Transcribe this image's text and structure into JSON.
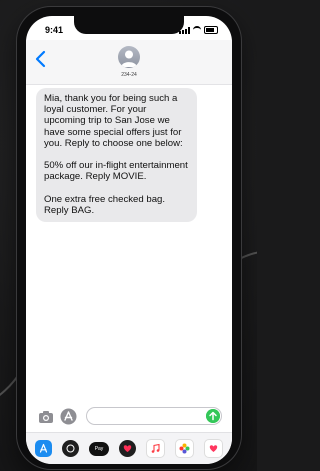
{
  "status_bar": {
    "time": "9:41"
  },
  "header": {
    "sender": "234-24"
  },
  "message": {
    "text": "Mia, thank you for being such a loyal customer. For your upcoming trip to San Jose we have some special offers just for you. Reply to choose one below:\n\n50% off our in-flight entertainment package. Reply MOVIE.\n\nOne extra free checked bag. Reply BAG."
  },
  "app_strip": {
    "pay_label": "Pay"
  },
  "colors": {
    "bubble": "#e9e9eb",
    "accent_blue": "#007aff",
    "send_green": "#34c759"
  },
  "icons": [
    "back-icon",
    "avatar",
    "camera-icon",
    "app-store-icon",
    "send-icon",
    "app-store-app-icon",
    "apple-pay-icon",
    "heart-icon",
    "music-icon",
    "photos-icon",
    "more-apps-icon"
  ]
}
